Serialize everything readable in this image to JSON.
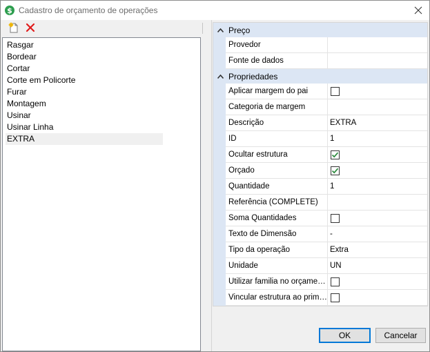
{
  "window": {
    "title": "Cadastro de orçamento de operações",
    "icon": "dollar-sign-icon",
    "accent_color": "#dce6f4"
  },
  "toolbar": {
    "new_icon": "new-document-icon",
    "delete_icon": "delete-x-icon"
  },
  "operations": {
    "items": [
      {
        "label": "Rasgar"
      },
      {
        "label": "Bordear"
      },
      {
        "label": "Cortar"
      },
      {
        "label": "Corte em Policorte"
      },
      {
        "label": "Furar"
      },
      {
        "label": "Montagem"
      },
      {
        "label": "Usinar"
      },
      {
        "label": "Usinar Linha"
      },
      {
        "label": "EXTRA"
      }
    ],
    "selected": "EXTRA"
  },
  "grid": {
    "categories": [
      {
        "label": "Preço",
        "rows": [
          {
            "name": "Provedor",
            "value": ""
          },
          {
            "name": "Fonte de dados",
            "value": ""
          }
        ]
      },
      {
        "label": "Propriedades",
        "rows": [
          {
            "name": "Aplicar margem do pai",
            "checkbox": true,
            "checked": false
          },
          {
            "name": "Categoria de margem",
            "value": ""
          },
          {
            "name": "Descrição",
            "value": "EXTRA"
          },
          {
            "name": "ID",
            "value": "1"
          },
          {
            "name": "Ocultar estrutura",
            "checkbox": true,
            "checked": true
          },
          {
            "name": "Orçado",
            "checkbox": true,
            "checked": true
          },
          {
            "name": "Quantidade",
            "value": "1"
          },
          {
            "name": "Referência (COMPLETE)",
            "value": ""
          },
          {
            "name": "Soma Quantidades",
            "checkbox": true,
            "checked": false
          },
          {
            "name": "Texto de Dimensão",
            "value": "-"
          },
          {
            "name": "Tipo da operação",
            "value": "Extra"
          },
          {
            "name": "Unidade",
            "value": "UN"
          },
          {
            "name": "Utilizar familia no orçamento",
            "checkbox": true,
            "checked": false
          },
          {
            "name": "Vincular estrutura ao primário",
            "checkbox": true,
            "checked": false
          }
        ]
      }
    ]
  },
  "buttons": {
    "ok_label": "OK",
    "cancel_label": "Cancelar"
  }
}
